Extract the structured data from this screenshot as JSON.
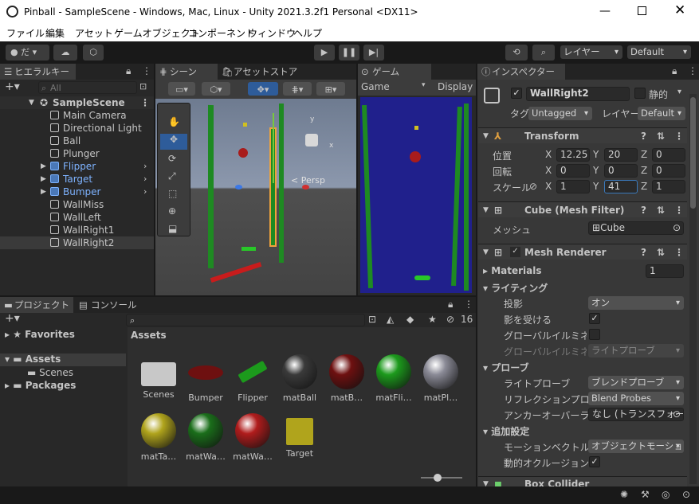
{
  "window": {
    "title": "Pinball - SampleScene - Windows, Mac, Linux - Unity 2021.3.2f1 Personal <DX11>"
  },
  "menu": [
    "ファイル",
    "編集",
    "アセット",
    "ゲームオブジェクト",
    "コンポーネント",
    "ウィンドウ",
    "ヘルプ"
  ],
  "toolbar": {
    "account": "だ",
    "layers": "レイヤー",
    "layout": "Default"
  },
  "hierarchy": {
    "tab": "ヒエラルキー",
    "search_placeholder": "All",
    "scene": "SampleScene",
    "items": [
      {
        "name": "Main Camera",
        "prefab": false
      },
      {
        "name": "Directional Light",
        "prefab": false
      },
      {
        "name": "Ball",
        "prefab": false
      },
      {
        "name": "Plunger",
        "prefab": false
      },
      {
        "name": "Flipper",
        "prefab": true
      },
      {
        "name": "Target",
        "prefab": true
      },
      {
        "name": "Bumper",
        "prefab": true
      },
      {
        "name": "WallMiss",
        "prefab": false
      },
      {
        "name": "WallLeft",
        "prefab": false
      },
      {
        "name": "WallRight1",
        "prefab": false
      },
      {
        "name": "WallRight2",
        "prefab": false
      }
    ]
  },
  "scene": {
    "tab": "シーン",
    "tab2": "アセットストア",
    "persp": "< Persp",
    "gizmo_y": "y",
    "gizmo_x": "x"
  },
  "game": {
    "tab": "ゲーム",
    "display_mode": "Game",
    "display": "Display"
  },
  "project": {
    "tab": "プロジェクト",
    "tab2": "コンソール",
    "count": "16",
    "favorites": "Favorites",
    "assets": "Assets",
    "scenes": "Scenes",
    "packages": "Packages",
    "assets_header": "Assets",
    "items": [
      {
        "name": "Scenes",
        "kind": "folder"
      },
      {
        "name": "Bumper",
        "kind": "bumper"
      },
      {
        "name": "Flipper",
        "kind": "flipper"
      },
      {
        "name": "matBall",
        "kind": "sphere",
        "color": "#3a3a3a"
      },
      {
        "name": "matB…",
        "kind": "sphere",
        "color": "#6e1010"
      },
      {
        "name": "matFli…",
        "kind": "sphere",
        "color": "#1c9a1c"
      },
      {
        "name": "matPl…",
        "kind": "sphere",
        "color": "#8a8a96"
      },
      {
        "name": "matTa…",
        "kind": "sphere",
        "color": "#b0a41c"
      },
      {
        "name": "matWa…",
        "kind": "sphere",
        "color": "#1a6e1a"
      },
      {
        "name": "matWa…",
        "kind": "sphere",
        "color": "#b01c1c"
      },
      {
        "name": "Target",
        "kind": "cube"
      }
    ]
  },
  "inspector": {
    "tab": "インスペクター",
    "object_name": "WallRight2",
    "static": "静的",
    "tag_label": "タグ",
    "tag": "Untagged",
    "layer_label": "レイヤー",
    "layer": "Default",
    "transform": {
      "title": "Transform",
      "pos_label": "位置",
      "rot_label": "回転",
      "scale_label": "スケール",
      "pos": [
        "12.25",
        "20",
        "0"
      ],
      "rot": [
        "0",
        "0",
        "0"
      ],
      "scale": [
        "1",
        "41",
        "1"
      ]
    },
    "mesh_filter": {
      "title": "Cube (Mesh Filter)",
      "mesh_label": "メッシュ",
      "mesh": "Cube"
    },
    "mesh_renderer": {
      "title": "Mesh Renderer",
      "materials": "Materials",
      "materials_count": "1",
      "lighting": "ライティング",
      "cast_shadows_label": "投影",
      "cast_shadows": "オン",
      "receive_shadows_label": "影を受ける",
      "gi_label": "グローバルイルミネーシ",
      "gi2_label": "グローバルイルミネーシ",
      "gi2": "ライトプローブ",
      "probes": "プローブ",
      "light_probes_label": "ライトプローブ",
      "light_probes": "ブレンドプローブ",
      "reflection_label": "リフレクションプローブ",
      "reflection": "Blend Probes",
      "anchor_label": "アンカーオーバーライド",
      "anchor": "なし (トランスフォーム",
      "additional": "追加設定",
      "motion_label": "モーションベクトル",
      "motion": "オブジェクトモーションご",
      "occlusion_label": "動的オクルージョン"
    },
    "box_collider": {
      "title": "Box Collider"
    }
  }
}
